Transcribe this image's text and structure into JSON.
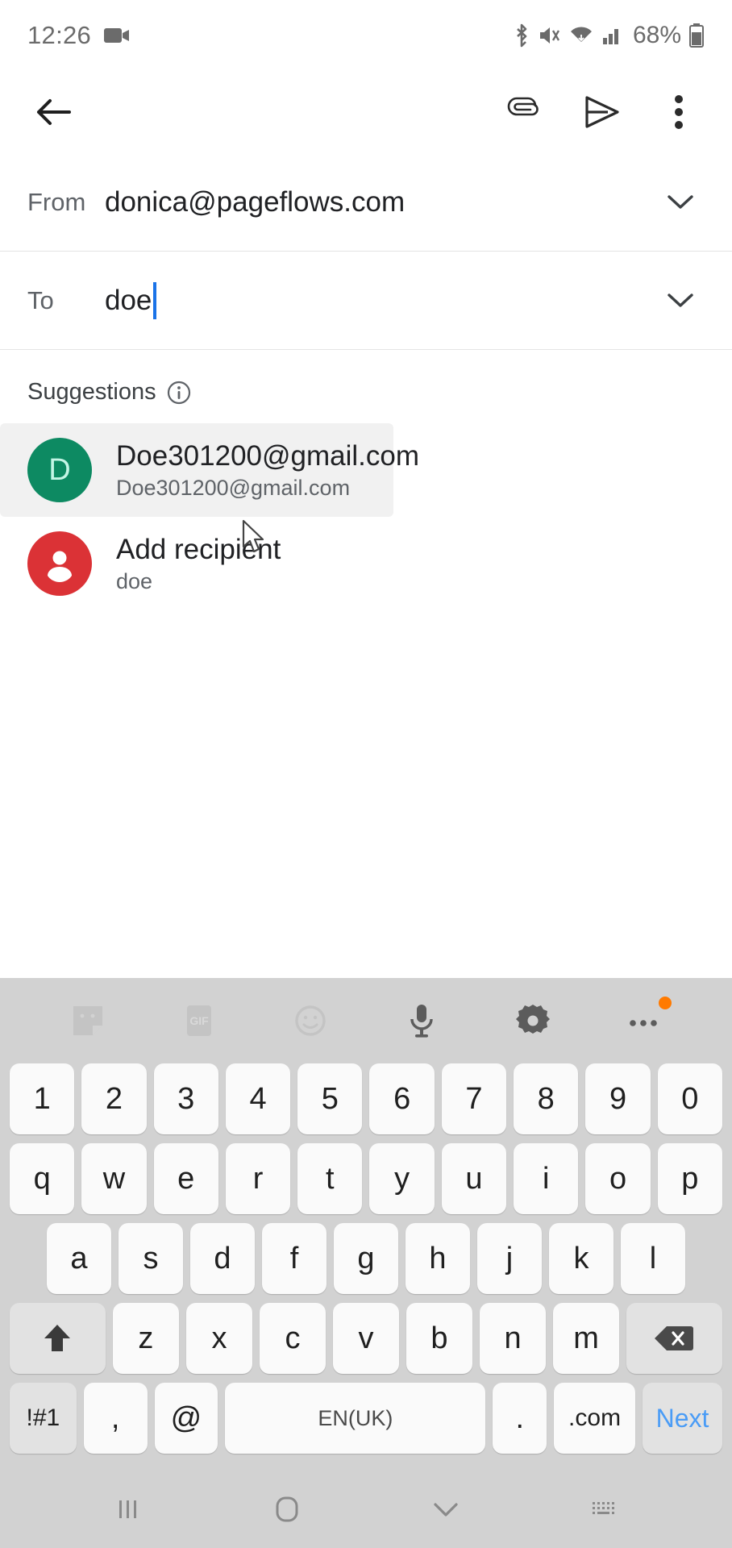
{
  "status_bar": {
    "time": "12:26",
    "battery_percent": "68%",
    "icons": [
      "video-camera-icon",
      "bluetooth-icon",
      "mute-icon",
      "wifi-icon",
      "signal-icon",
      "battery-icon"
    ]
  },
  "toolbar": {
    "back_label": "back-arrow",
    "attach_label": "attachment",
    "send_label": "send",
    "more_label": "more-options"
  },
  "compose": {
    "from": {
      "label": "From",
      "value": "donica@pageflows.com"
    },
    "to": {
      "label": "To",
      "value": "doe"
    }
  },
  "suggestions": {
    "title": "Suggestions",
    "info_icon": "info-icon",
    "items": [
      {
        "avatar_letter": "D",
        "avatar_color": "#0d8a62",
        "primary": "Doe301200@gmail.com",
        "secondary": "Doe301200@gmail.com",
        "selected": true
      },
      {
        "avatar_letter": "",
        "avatar_color": "#db3236",
        "primary": "Add recipient",
        "secondary": "doe",
        "selected": false
      }
    ]
  },
  "keyboard": {
    "toolbar_icons": [
      "sticker-icon",
      "gif-icon",
      "emoji-icon",
      "microphone-icon",
      "settings-gear-icon",
      "more-dots-icon"
    ],
    "row_numbers": [
      "1",
      "2",
      "3",
      "4",
      "5",
      "6",
      "7",
      "8",
      "9",
      "0"
    ],
    "row_top": [
      "q",
      "w",
      "e",
      "r",
      "t",
      "y",
      "u",
      "i",
      "o",
      "p"
    ],
    "row_home": [
      "a",
      "s",
      "d",
      "f",
      "g",
      "h",
      "j",
      "k",
      "l"
    ],
    "row_bottom": [
      "z",
      "x",
      "c",
      "v",
      "b",
      "n",
      "m"
    ],
    "shift_key": "shift-icon",
    "backspace_key": "backspace-icon",
    "symbols_key": "!#1",
    "comma_key": ",",
    "at_key": "@",
    "space_key": "EN(UK)",
    "period_key": ".",
    "dotcom_key": ".com",
    "next_key": "Next"
  },
  "navbar": {
    "recents": "recent-apps-icon",
    "home": "home-icon",
    "hide_keyboard": "hide-keyboard-icon",
    "keyboard_switch": "keyboard-switch-icon"
  }
}
